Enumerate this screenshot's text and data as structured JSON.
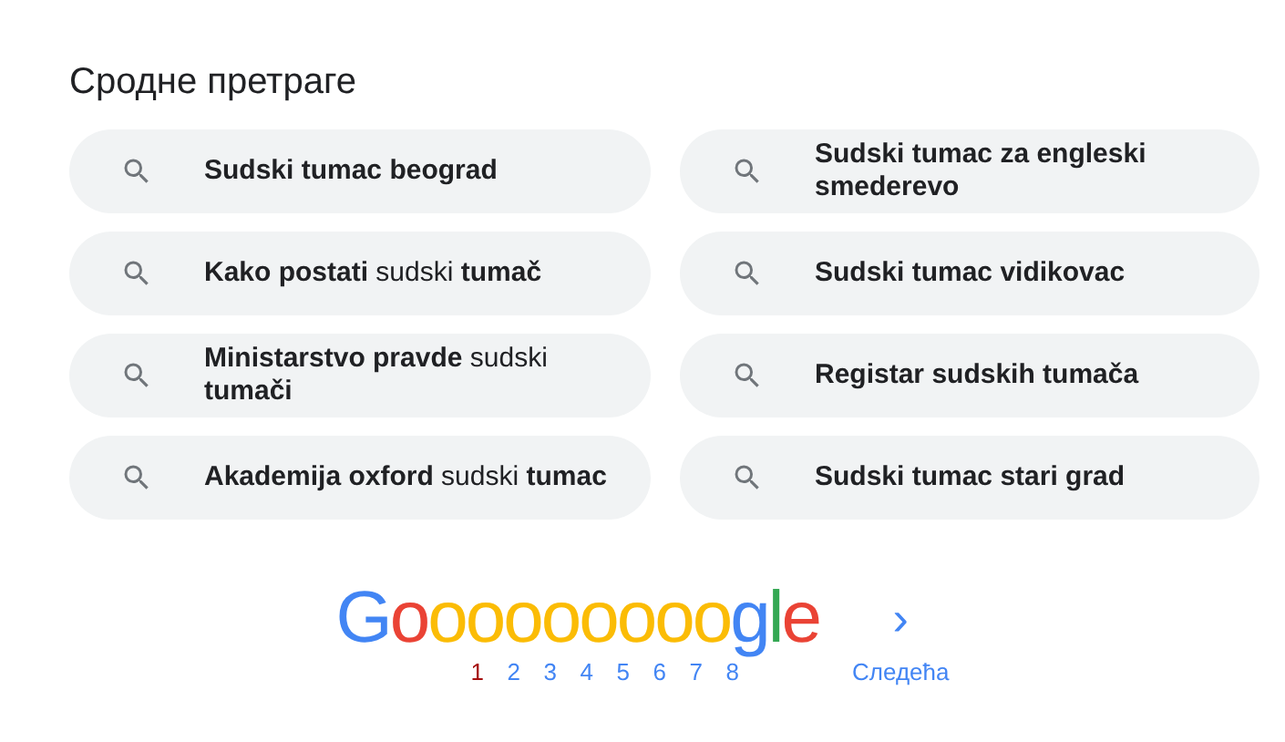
{
  "heading": "Сродне претраге",
  "searches": [
    {
      "text": "Sudski tumac beograd",
      "all_bold": true
    },
    {
      "text": "Sudski tumac za engleski smederevo",
      "all_bold": true
    },
    {
      "text": "**Kako postati** sudski **tumač**",
      "all_bold": false
    },
    {
      "text": "Sudski tumac vidikovac",
      "all_bold": true
    },
    {
      "text": "**Ministarstvo pravde** sudski **tumači**",
      "all_bold": false
    },
    {
      "text": "Registar sudskih tumača",
      "all_bold": true
    },
    {
      "text": "**Akademija oxford** sudski **tumac**",
      "all_bold": false
    },
    {
      "text": "Sudski tumac stari grad",
      "all_bold": true
    }
  ],
  "pagination": {
    "logo": "Gooooooooogle",
    "next_arrow": "›",
    "pages": [
      {
        "label": "1",
        "selected": true
      },
      {
        "label": "2",
        "selected": false
      },
      {
        "label": "3",
        "selected": false
      },
      {
        "label": "4",
        "selected": false
      },
      {
        "label": "5",
        "selected": false
      },
      {
        "label": "6",
        "selected": false
      },
      {
        "label": "7",
        "selected": false
      },
      {
        "label": "8",
        "selected": false
      }
    ],
    "next_label": "Следећа"
  }
}
